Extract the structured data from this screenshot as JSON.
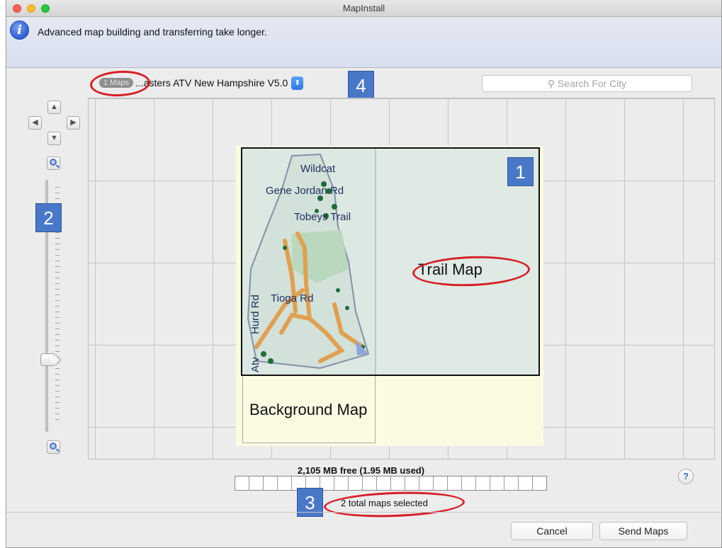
{
  "window": {
    "title": "MapInstall"
  },
  "info": {
    "message": "Advanced map building and transferring take longer.",
    "icon": "info-icon"
  },
  "map_select": {
    "badge": "1 Maps",
    "name": "...asters ATV New Hampshire V5.0"
  },
  "search": {
    "placeholder": "Search For City"
  },
  "callouts": {
    "one": "1",
    "two": "2",
    "three": "3",
    "four": "4"
  },
  "map": {
    "trail_label": "Trail Map",
    "background_label": "Background Map",
    "places": [
      "Wildcat",
      "Gene Jordan Rd",
      "Tobeys Trail",
      "Tioga Rd",
      "Hurd Rd",
      "Atv"
    ]
  },
  "status": {
    "free": "2,105 MB free (1.95 MB used)",
    "selected": "2 total maps selected"
  },
  "buttons": {
    "cancel": "Cancel",
    "send": "Send Maps",
    "help": "?"
  },
  "colors": {
    "accent": "#2a79e6",
    "callout": "#4a78c8",
    "annotation": "#d61f26",
    "trail": "#e0a050"
  }
}
